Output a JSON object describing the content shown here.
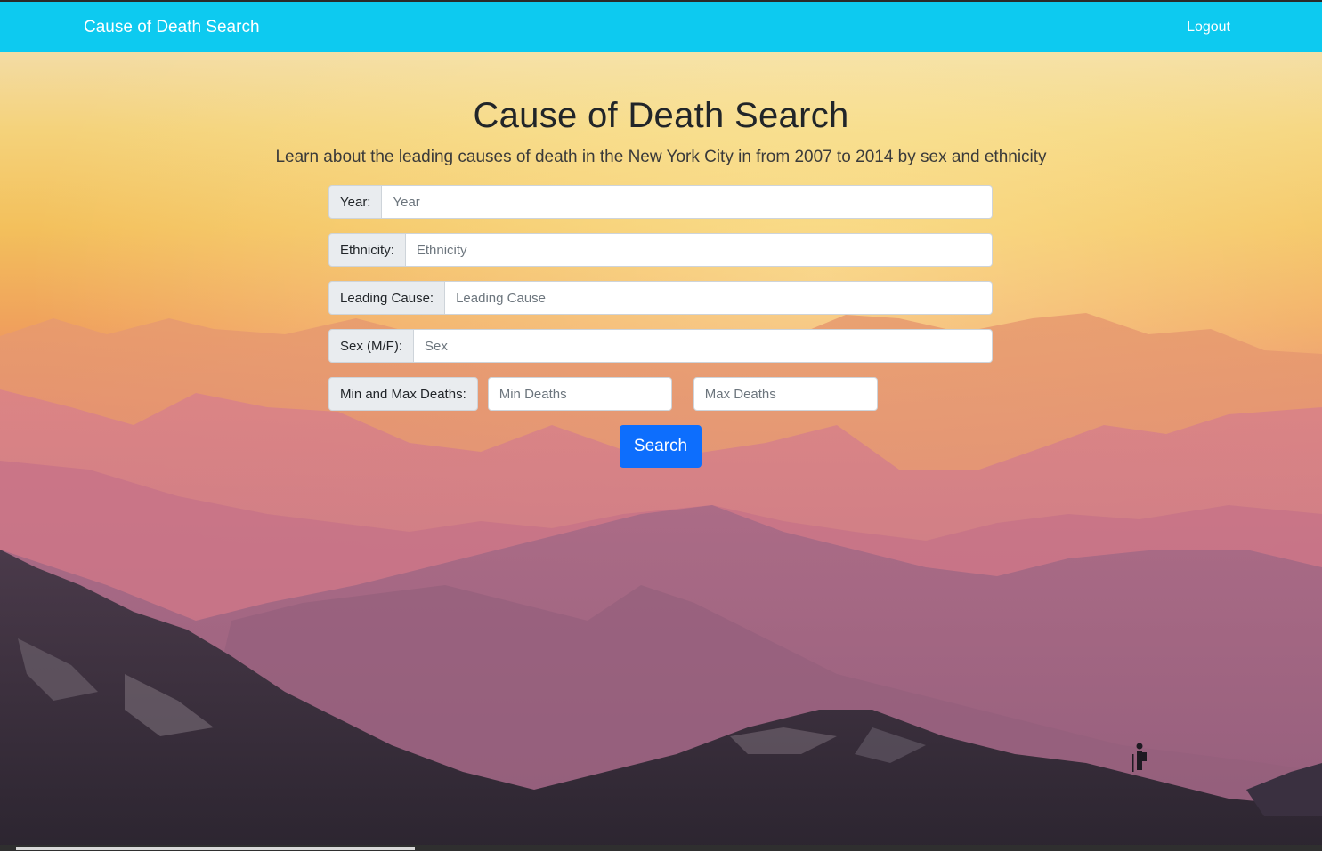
{
  "navbar": {
    "brand": "Cause of Death Search",
    "logout": "Logout",
    "color": "#0dcaf0"
  },
  "header": {
    "title": "Cause of Death Search",
    "subtitle": "Learn about the leading causes of death in the New York City in from 2007 to 2014 by sex and ethnicity"
  },
  "form": {
    "year": {
      "label": "Year:",
      "placeholder": "Year",
      "value": ""
    },
    "ethnicity": {
      "label": "Ethnicity:",
      "placeholder": "Ethnicity",
      "value": ""
    },
    "leading_cause": {
      "label": "Leading Cause:",
      "placeholder": "Leading Cause",
      "value": ""
    },
    "sex": {
      "label": "Sex (M/F):",
      "placeholder": "Sex",
      "value": ""
    },
    "deaths": {
      "label": "Min and Max Deaths:",
      "min_placeholder": "Min Deaths",
      "max_placeholder": "Max Deaths"
    },
    "search_label": "Search",
    "button_color": "#0d6efd"
  },
  "background": {
    "description_icon": "mountain-landscape-image"
  }
}
